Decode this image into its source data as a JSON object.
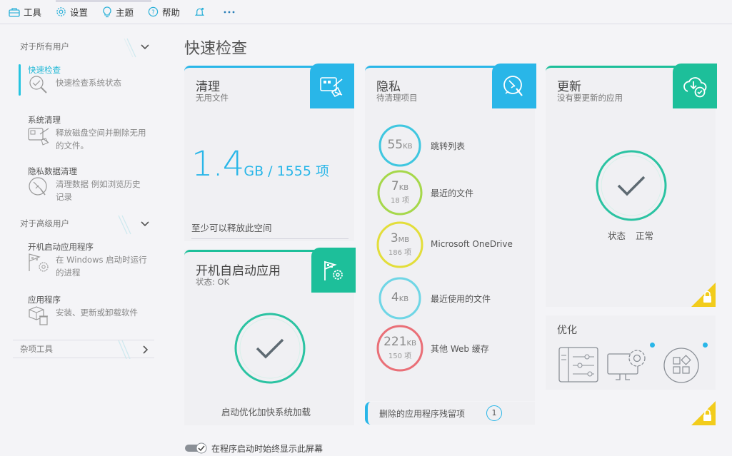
{
  "toolbar": {
    "tools": "工具",
    "settings": "设置",
    "theme": "主题",
    "help": "帮助"
  },
  "sidebar": {
    "section_all": "对于所有用户",
    "quick_check_title": "快速检查",
    "quick_check_desc": "快速检查系统状态",
    "sys_clean_title": "系统清理",
    "sys_clean_desc": "释放磁盘空间并删除无用的文件。",
    "privacy_title": "隐私数据清理",
    "privacy_desc": "清理数据 例如浏览历史记录",
    "section_adv": "对于高级用户",
    "startup_title": "开机启动应用程序",
    "startup_desc": "在 Windows 启动时运行的进程",
    "apps_title": "应用程序",
    "apps_desc": "安装、更新或卸载软件",
    "section_misc": "杂项工具"
  },
  "main": {
    "page_title": "快速检查",
    "clean": {
      "title": "清理",
      "subtitle": "无用文件",
      "size_value": "1.4",
      "size_unit": "GB",
      "size_sep": " / ",
      "items": "1555 项",
      "note": "至少可以释放此空间"
    },
    "startup": {
      "title": "开机自启动应用",
      "subtitle": "状态: OK",
      "note": "启动优化加快系统加载"
    },
    "privacy": {
      "title": "隐私",
      "subtitle": "待清理项目",
      "rows": [
        {
          "value": "55",
          "unit": "KB",
          "count": "",
          "label": "跳转列表",
          "color": "#3fc7e0"
        },
        {
          "value": "7",
          "unit": "KB",
          "count": "18 项",
          "label": "最近的文件",
          "color": "#a6d84a"
        },
        {
          "value": "3",
          "unit": "MB",
          "count": "186 项",
          "label": "Microsoft OneDrive",
          "color": "#e3de3a"
        },
        {
          "value": "4",
          "unit": "KB",
          "count": "",
          "label": "最近使用的文件",
          "color": "#6fd6e6"
        },
        {
          "value": "221",
          "unit": "KB",
          "count": "150 项",
          "label": "其他 Web 缓存",
          "color": "#ea6f77"
        }
      ],
      "removed_label": "删除的应用程序残留项",
      "removed_count": "1"
    },
    "update": {
      "title": "更新",
      "subtitle": "没有要更新的应用",
      "status_label": "状态",
      "status_value": "正常"
    },
    "optimize": {
      "title": "优化"
    },
    "footer_checkbox": "在程序启动时始终显示此屏幕"
  },
  "colors": {
    "accent_blue": "#29b6e8",
    "accent_teal": "#1dbf9a",
    "check_teal": "#2bc3a2",
    "lock_yellow": "#f2cc1b"
  }
}
